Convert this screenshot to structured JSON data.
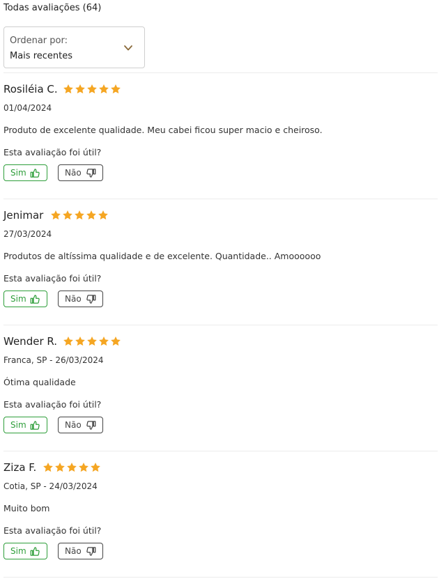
{
  "header": {
    "count_label": "Todas avaliações (64)"
  },
  "sort": {
    "label": "Ordenar por:",
    "value": "Mais recentes",
    "icon": "chevron-down-icon"
  },
  "colors": {
    "star": "#f5a623",
    "yes": "#2e9e3a",
    "no": "#444444"
  },
  "reviews": [
    {
      "name": "Rosiléia C.",
      "rating": 5,
      "meta": "01/04/2024",
      "text": "Produto de excelente qualidade. Meu cabei ficou super macio e cheiroso.",
      "helpful_question": "Esta avaliação foi útil?",
      "yes_label": "Sim",
      "no_label": "Não"
    },
    {
      "name": "Jenimar",
      "rating": 5,
      "meta": "27/03/2024",
      "text": "Produtos de altíssima qualidade e de excelente. Quantidade.. Amoooooo",
      "helpful_question": "Esta avaliação foi útil?",
      "yes_label": "Sim",
      "no_label": "Não"
    },
    {
      "name": "Wender R.",
      "rating": 5,
      "meta": "Franca, SP - 26/03/2024",
      "text": "Ótima qualidade",
      "helpful_question": "Esta avaliação foi útil?",
      "yes_label": "Sim",
      "no_label": "Não"
    },
    {
      "name": "Ziza F.",
      "rating": 5,
      "meta": "Cotia, SP - 24/03/2024",
      "text": "Muito bom",
      "helpful_question": "Esta avaliação foi útil?",
      "yes_label": "Sim",
      "no_label": "Não"
    }
  ]
}
